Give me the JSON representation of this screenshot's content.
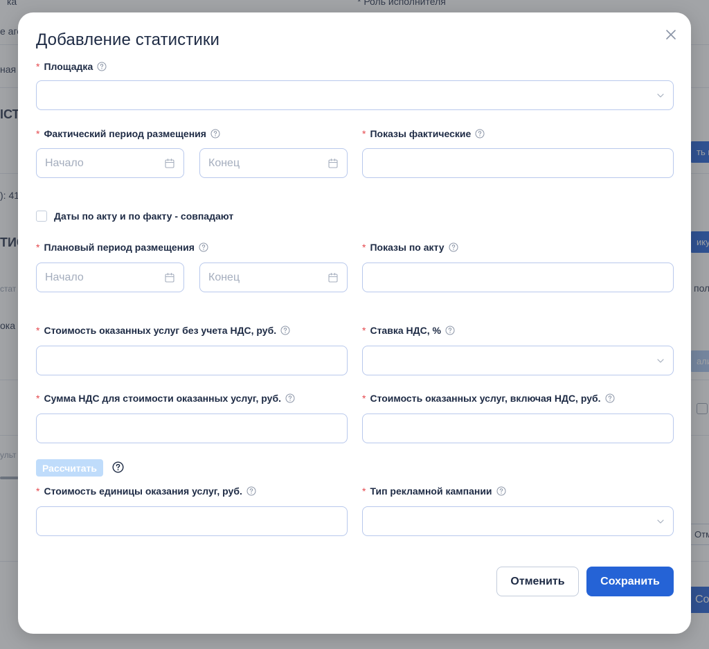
{
  "background": {
    "fragments": [
      "ка",
      "* Роль исполнителя",
      "е аге",
      "ная",
      "ІСТ",
      "ть кр",
      "): 41",
      "ТИС",
      "ику",
      "стат",
      "пол",
      "ока",
      "али",
      "ульт",
      "Отме",
      "Сох"
    ]
  },
  "modal": {
    "title": "Добавление статистики",
    "close_icon": "close-icon"
  },
  "form": {
    "required_mark": "*",
    "platform": {
      "label": "Площадка",
      "value": ""
    },
    "actual_period": {
      "label": "Фактический период размещения",
      "start_placeholder": "Начало",
      "end_placeholder": "Конец"
    },
    "actual_impressions": {
      "label": "Показы фактические",
      "value": ""
    },
    "dates_match": {
      "label": "Даты по акту и по факту - совпадают",
      "checked": false
    },
    "planned_period": {
      "label": "Плановый период размещения",
      "start_placeholder": "Начало",
      "end_placeholder": "Конец"
    },
    "act_impressions": {
      "label": "Показы по акту",
      "value": ""
    },
    "cost_without_vat": {
      "label": "Стоимость оказанных услуг без учета НДС, руб.",
      "value": ""
    },
    "vat_rate": {
      "label": "Ставка НДС, %",
      "value": ""
    },
    "vat_amount": {
      "label": "Сумма НДС для стоимости оказанных услуг, руб.",
      "value": ""
    },
    "cost_with_vat": {
      "label": "Стоимость оказанных услуг, включая НДС, руб.",
      "value": ""
    },
    "calculate_button": "Рассчитать",
    "unit_cost": {
      "label": "Стоимость единицы оказания услуг, руб.",
      "value": ""
    },
    "campaign_type": {
      "label": "Тип рекламной кампании",
      "value": ""
    }
  },
  "actions": {
    "cancel": "Отменить",
    "save": "Сохранить"
  },
  "colors": {
    "primary": "#2563d6",
    "required": "#e5484d",
    "input_border": "#b8c8ec",
    "disabled_button": "#bfdcfb"
  }
}
